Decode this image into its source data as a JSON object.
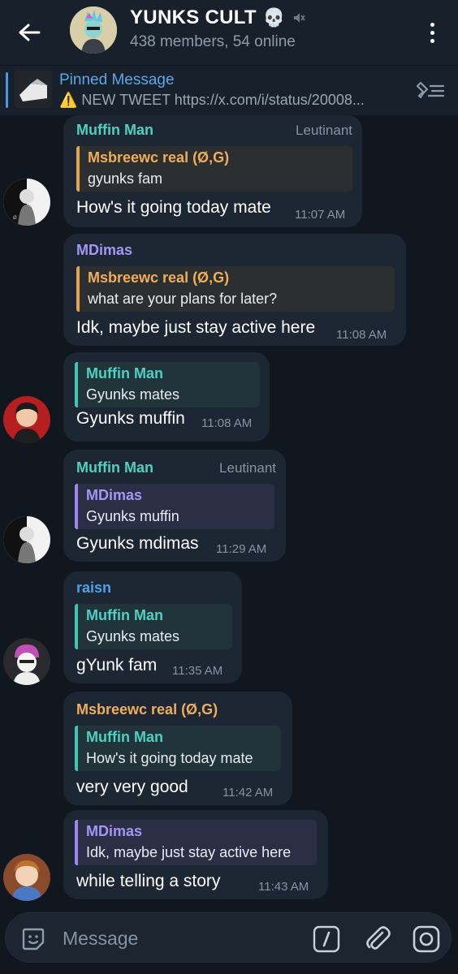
{
  "header": {
    "title": "YUNKS CULT",
    "title_emoji": "💀",
    "subtitle": "438 members, 54 online"
  },
  "pinned": {
    "title": "Pinned Message",
    "text": "⚠️ NEW TWEET   https://x.com/i/status/20008..."
  },
  "messages": [
    {
      "sender": "Muffin Man",
      "role": "Leutinant",
      "reply_name": "Msbreewc real (Ø,G)",
      "reply_text": "gyunks fam",
      "text": "How's it going today mate",
      "time": "11:07 AM"
    },
    {
      "sender": "MDimas",
      "role": "",
      "reply_name": "Msbreewc real (Ø,G)",
      "reply_text": "what are your plans for later?",
      "text": "Idk, maybe just stay active here",
      "time": "11:08 AM"
    },
    {
      "sender": "",
      "role": "",
      "reply_name": "Muffin Man",
      "reply_text": "Gyunks mates",
      "text": "Gyunks muffin",
      "time": "11:08 AM"
    },
    {
      "sender": "Muffin Man",
      "role": "Leutinant",
      "reply_name": "MDimas",
      "reply_text": "Gyunks muffin",
      "text": "Gyunks mdimas",
      "time": "11:29 AM"
    },
    {
      "sender": "raisn",
      "role": "",
      "reply_name": "Muffin Man",
      "reply_text": "Gyunks mates",
      "text": "gYunk fam",
      "time": "11:35 AM"
    },
    {
      "sender": "Msbreewc real (Ø,G)",
      "role": "",
      "reply_name": "Muffin Man",
      "reply_text": "How's it going today mate",
      "text": "very very good",
      "time": "11:42 AM"
    },
    {
      "sender": "",
      "role": "",
      "reply_name": "MDimas",
      "reply_text": "Idk, maybe just stay active here",
      "text": "while telling a story",
      "time": "11:43 AM"
    }
  ],
  "composer": {
    "placeholder": "Message"
  },
  "colors": {
    "background": "#10171f",
    "bubble": "#1d2733",
    "teal": "#4fd0c2",
    "purple": "#a595f5",
    "orange": "#f0ad5a",
    "link": "#5aa8e8"
  }
}
